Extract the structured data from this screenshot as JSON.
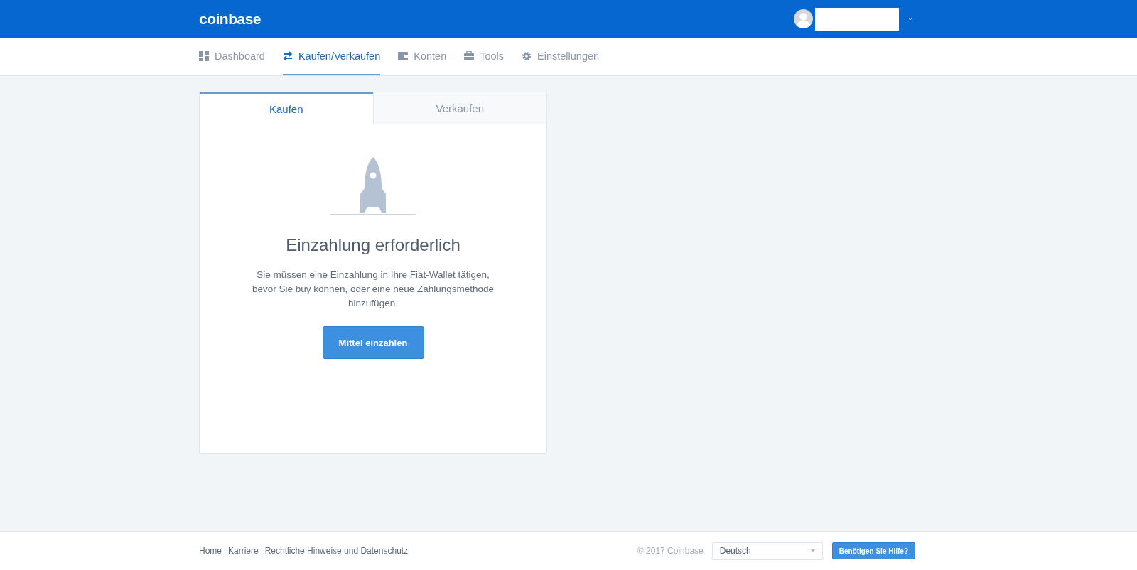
{
  "header": {
    "logo": "coinbase"
  },
  "nav": [
    {
      "label": "Dashboard",
      "kind": "dashboard",
      "selected": false
    },
    {
      "label": "Kaufen/Verkaufen",
      "kind": "trade",
      "selected": true
    },
    {
      "label": "Konten",
      "kind": "accounts",
      "selected": false
    },
    {
      "label": "Tools",
      "kind": "tools",
      "selected": false
    },
    {
      "label": "Einstellungen",
      "kind": "settings",
      "selected": false
    }
  ],
  "card": {
    "tabs": [
      {
        "label": "Kaufen",
        "selected": true
      },
      {
        "label": "Verkaufen",
        "selected": false
      }
    ],
    "title": "Einzahlung erforderlich",
    "message": "Sie müssen eine Einzahlung in Ihre Fiat-Wallet tätigen, bevor Sie buy können, oder eine neue Zahlungsmethode hinzufügen.",
    "button": "Mittel einzahlen"
  },
  "footer": {
    "links": [
      "Home",
      "Karriere",
      "Rechtliche Hinweise und Datenschutz"
    ],
    "copyright": "© 2017 Coinbase",
    "language": "Deutsch",
    "help_button": "Benötigen Sie Hilfe?"
  }
}
